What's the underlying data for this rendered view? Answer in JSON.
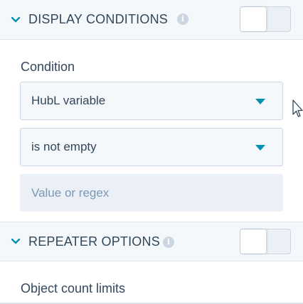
{
  "display_conditions": {
    "title": "DISPLAY CONDITIONS",
    "icon": "chevron-down-icon",
    "info_icon": "info-icon",
    "info_glyph": "i",
    "toggle_on": false
  },
  "condition": {
    "label": "Condition",
    "variable_select": {
      "value": "HubL variable"
    },
    "operator_select": {
      "value": "is not empty"
    },
    "value_input": {
      "placeholder": "Value or regex",
      "value": ""
    }
  },
  "repeater_options": {
    "title": "REPEATER OPTIONS",
    "icon": "chevron-down-icon",
    "info_icon": "info-icon",
    "info_glyph": "i",
    "toggle_on": false
  },
  "object_count": {
    "label": "Object count limits"
  },
  "colors": {
    "accent": "#0091ae",
    "header_bg": "#f5f8fa",
    "text": "#33475b",
    "placeholder": "#7c98b6"
  }
}
